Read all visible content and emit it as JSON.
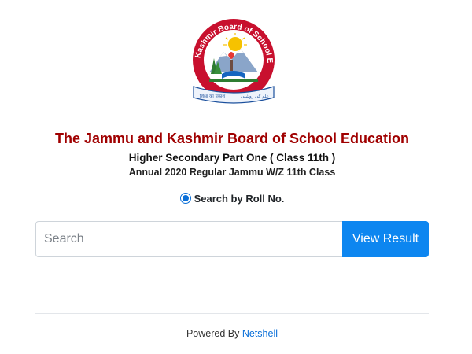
{
  "logo": {
    "ring_text": "Jammu & Kashmir Board of School Education",
    "banner_left": "शिक्षा का प्रकाश",
    "banner_right": "علم کی روشنی"
  },
  "header": {
    "title": "The Jammu and Kashmir Board of School Education",
    "subtitle": "Higher Secondary Part One ( Class 11th )",
    "session": "Annual 2020 Regular Jammu W/Z 11th Class"
  },
  "search": {
    "radio_label": "Search by Roll No.",
    "radio_checked": true,
    "placeholder": "Search",
    "value": "",
    "button_label": "View Result"
  },
  "footer": {
    "prefix": "Powered By ",
    "link_text": "Netshell"
  },
  "colors": {
    "title": "#a00000",
    "accent": "#0d86f0"
  }
}
